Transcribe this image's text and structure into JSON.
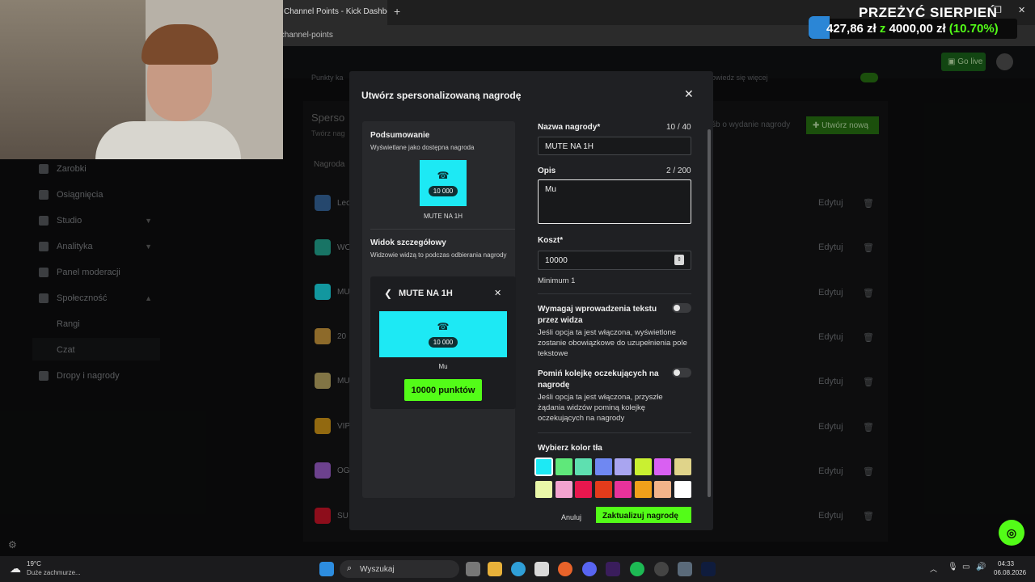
{
  "browser": {
    "tab_title": "Channel Points - Kick Dashboard",
    "tab_close": "✕",
    "new_tab": "+",
    "address": "/channel-points"
  },
  "kick": {
    "go_live": "Go live",
    "bg_text_top": "Punkty ka",
    "bg_text_top_right": "owiedz się więcej",
    "section_title": "Sperso",
    "section_sub": "Twórz nag",
    "section_right": "śb o wydanie nagrody",
    "create_new": "Utwórz nową",
    "table_head": "Nagroda",
    "edit_label": "Edytuj",
    "sidebar": [
      {
        "label": "Zarobki"
      },
      {
        "label": "Osiągnięcia"
      },
      {
        "label": "Studio"
      },
      {
        "label": "Analityka"
      },
      {
        "label": "Panel moderacji"
      },
      {
        "label": "Społeczność"
      },
      {
        "label": "Rangi"
      },
      {
        "label": "Czat"
      },
      {
        "label": "Dropy i nagrody"
      }
    ],
    "rows": [
      {
        "label": "Leo",
        "color": "#3a6ea8"
      },
      {
        "label": "WO",
        "color": "#25b39b"
      },
      {
        "label": "MU",
        "color": "#1de9f4"
      },
      {
        "label": "20",
        "color": "#d9a441"
      },
      {
        "label": "MU",
        "color": "#c6b26a"
      },
      {
        "label": "VIP",
        "color": "#e0a21a"
      },
      {
        "label": "OG",
        "color": "#a764d9"
      },
      {
        "label": "SU",
        "color": "#d9142a"
      }
    ]
  },
  "modal": {
    "title": "Utwórz spersonalizowaną nagrodę",
    "close": "✕",
    "summary_title": "Podsumowanie",
    "summary_sub": "Wyświetlane jako dostępna nagroda",
    "tile_cost": "10 000",
    "tile_name": "MUTE NA 1H",
    "detail_title": "Widok szczegółowy",
    "detail_sub": "Widzowie widzą to podczas odbierania nagrody",
    "detail_name": "MUTE NA 1H",
    "detail_desc": "Mu",
    "points_button": "10000 punktów",
    "name_label": "Nazwa nagrody*",
    "name_counter": "10 / 40",
    "name_value": "MUTE NA 1H",
    "desc_label": "Opis",
    "desc_counter": "2 / 200",
    "desc_value": "Mu",
    "cost_label": "Koszt*",
    "cost_value": "10000",
    "cost_min": "Minimum 1",
    "req_text_label": "Wymagaj wprowadzenia tekstu przez widza",
    "req_text_help": "Jeśli opcja ta jest włączona, wyświetlone zostanie obowiązkowe do uzupełnienia pole tekstowe",
    "skip_queue_label": "Pomiń kolejkę oczekujących na nagrodę",
    "skip_queue_help": "Jeśli opcja ta jest włączona, przyszłe żądania widzów pominą kolejkę oczekujących na nagrody",
    "color_label": "Wybierz kolor tła",
    "colors_row1": [
      "#1de9f4",
      "#5fe87a",
      "#5ee0b0",
      "#6f88f2",
      "#a9a5f0",
      "#c9f031",
      "#d960f2",
      "#e0d48a"
    ],
    "colors_row2": [
      "#e9f7a8",
      "#f2a3cf",
      "#e8174e",
      "#e33b1b",
      "#e8329b",
      "#f0a01a",
      "#f2b48a",
      "#ffffff"
    ],
    "cancel": "Anuluj",
    "submit": "Zaktualizuj nagrodę"
  },
  "promo": {
    "title": "PRZEŻYĆ SIERPIEŃ",
    "amount": "427,86 zł",
    "of": "z",
    "goal": "4000,00 zł",
    "pct": "(10.70%)"
  },
  "taskbar": {
    "weather_temp": "19°C",
    "weather_desc": "Duże zachmurze...",
    "search": "Wyszukaj",
    "time": "04:33",
    "date": "06.08.2026"
  }
}
